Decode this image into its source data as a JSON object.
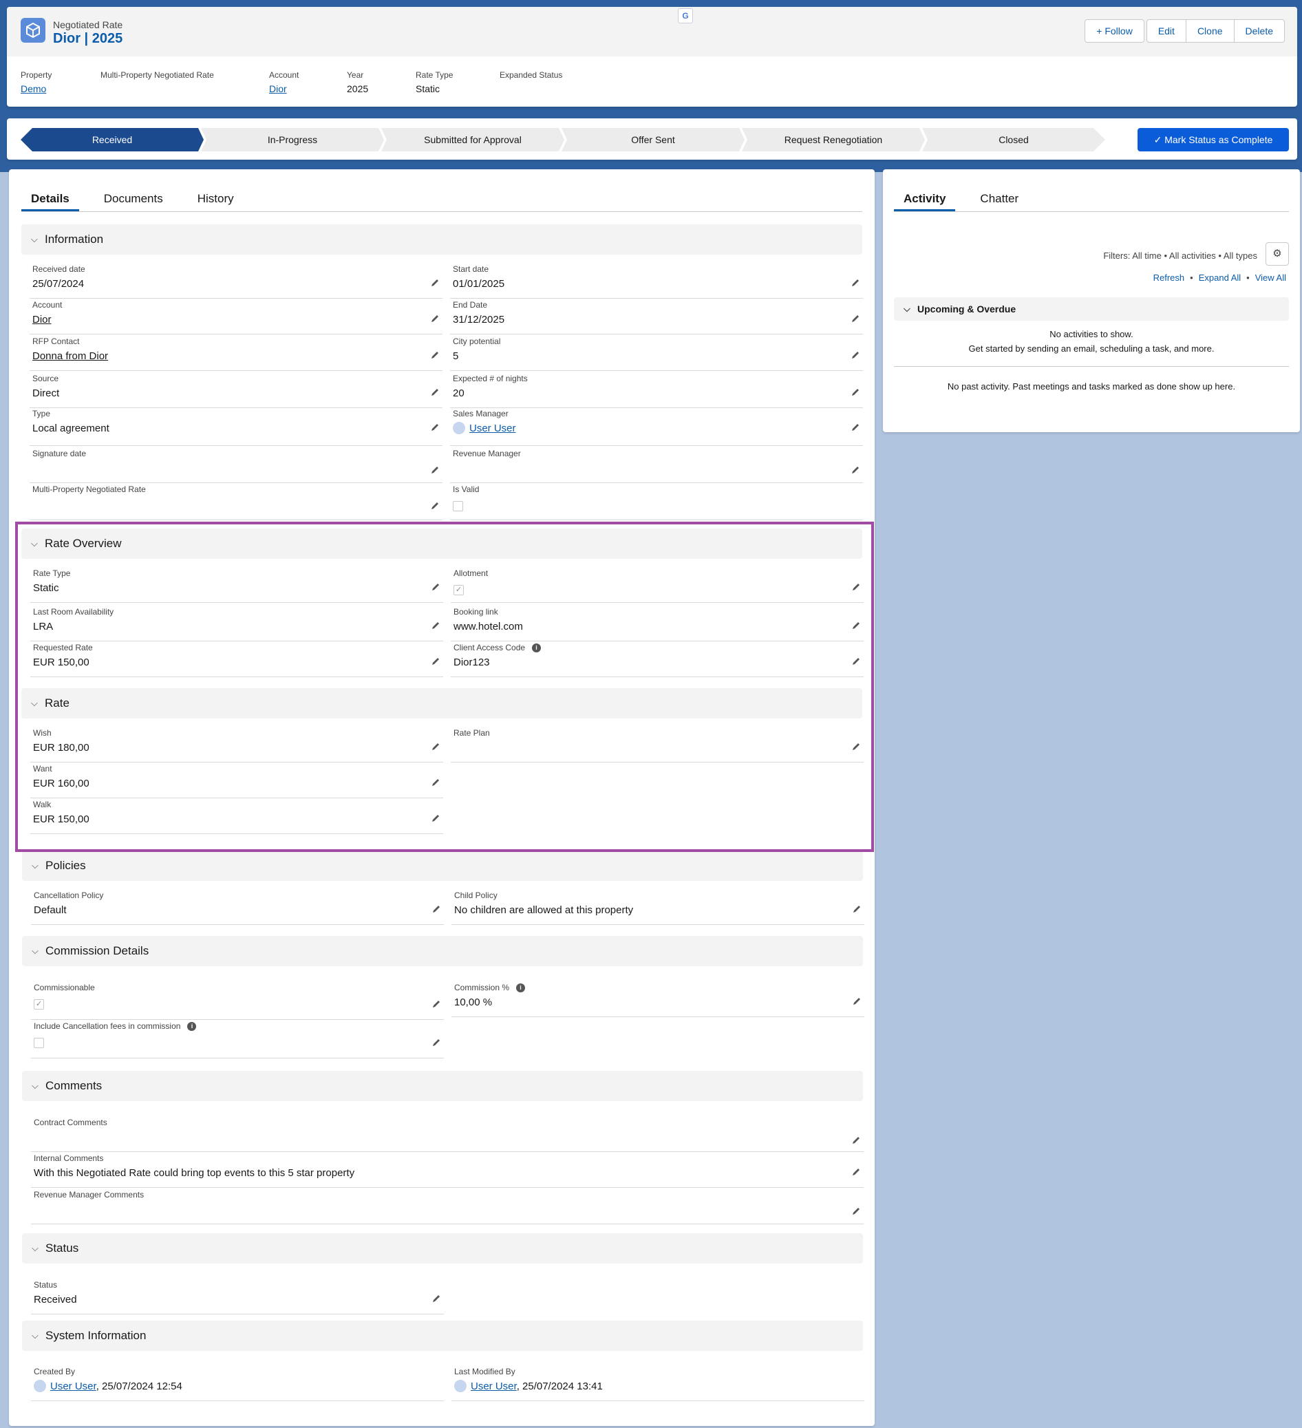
{
  "header": {
    "object_type": "Negotiated Rate",
    "title": "Dior | 2025",
    "buttons": {
      "follow": "Follow",
      "edit": "Edit",
      "clone": "Clone",
      "delete": "Delete"
    },
    "highlights": [
      {
        "label": "Property",
        "value": "Demo",
        "link": true
      },
      {
        "label": "Multi-Property Negotiated Rate",
        "value": "",
        "link": false
      },
      {
        "label": "Account",
        "value": "Dior",
        "link": true
      },
      {
        "label": "Year",
        "value": "2025",
        "link": false
      },
      {
        "label": "Rate Type",
        "value": "Static",
        "link": false
      },
      {
        "label": "Expanded Status",
        "value": "",
        "link": false
      }
    ]
  },
  "path": {
    "stages": [
      "Received",
      "In-Progress",
      "Submitted for Approval",
      "Offer Sent",
      "Request Renegotiation",
      "Closed"
    ],
    "active": "Received",
    "mark_button": "Mark Status as Complete"
  },
  "details": {
    "tabs": [
      "Details",
      "Documents",
      "History"
    ],
    "active_tab": "Details",
    "sections": {
      "information": "Information",
      "rate_overview": "Rate Overview",
      "rate": "Rate",
      "policies": "Policies",
      "commission": "Commission Details",
      "comments": "Comments",
      "status": "Status",
      "system": "System Information"
    },
    "fields": {
      "received_date": {
        "label": "Received date",
        "value": "25/07/2024"
      },
      "start_date": {
        "label": "Start date",
        "value": "01/01/2025"
      },
      "account": {
        "label": "Account",
        "value": "Dior"
      },
      "end_date": {
        "label": "End Date",
        "value": "31/12/2025"
      },
      "rfp_contact": {
        "label": "RFP Contact",
        "value": "Donna from Dior"
      },
      "city_potential": {
        "label": "City potential",
        "value": "5"
      },
      "source": {
        "label": "Source",
        "value": "Direct"
      },
      "expected_nights": {
        "label": "Expected # of nights",
        "value": "20"
      },
      "type": {
        "label": "Type",
        "value": "Local agreement"
      },
      "sales_manager": {
        "label": "Sales Manager",
        "value": "User User"
      },
      "signature_date": {
        "label": "Signature date",
        "value": ""
      },
      "revenue_manager": {
        "label": "Revenue Manager",
        "value": ""
      },
      "multi_property": {
        "label": "Multi-Property Negotiated Rate",
        "value": ""
      },
      "is_valid": {
        "label": "Is Valid",
        "checked": false
      },
      "rate_type": {
        "label": "Rate Type",
        "value": "Static"
      },
      "allotment": {
        "label": "Allotment",
        "checked": true
      },
      "lra": {
        "label": "Last Room Availability",
        "value": "LRA"
      },
      "booking_link": {
        "label": "Booking link",
        "value": "www.hotel.com"
      },
      "requested_rate": {
        "label": "Requested Rate",
        "value": "EUR 150,00"
      },
      "client_access_code": {
        "label": "Client Access Code",
        "value": "Dior123"
      },
      "wish": {
        "label": "Wish",
        "value": "EUR 180,00"
      },
      "rate_plan": {
        "label": "Rate Plan",
        "value": ""
      },
      "want": {
        "label": "Want",
        "value": "EUR 160,00"
      },
      "walk": {
        "label": "Walk",
        "value": "EUR 150,00"
      },
      "cancellation_policy": {
        "label": "Cancellation Policy",
        "value": "Default"
      },
      "child_policy": {
        "label": "Child Policy",
        "value": "No children are allowed at this property"
      },
      "commissionable": {
        "label": "Commissionable",
        "checked": true
      },
      "commission_pct": {
        "label": "Commission %",
        "value": "10,00 %"
      },
      "include_cancel_fees": {
        "label": "Include Cancellation fees in commission",
        "checked": false
      },
      "contract_comments": {
        "label": "Contract Comments",
        "value": ""
      },
      "internal_comments": {
        "label": "Internal Comments",
        "value": "With this Negotiated Rate could bring top events to this 5 star property"
      },
      "rm_comments": {
        "label": "Revenue Manager Comments",
        "value": ""
      },
      "status": {
        "label": "Status",
        "value": "Received"
      },
      "created_by": {
        "label": "Created By",
        "user": "User User",
        "date": ", 25/07/2024 12:54"
      },
      "last_modified_by": {
        "label": "Last Modified By",
        "user": "User User",
        "date": ", 25/07/2024 13:41"
      }
    }
  },
  "activity": {
    "tabs": [
      "Activity",
      "Chatter"
    ],
    "active_tab": "Activity",
    "filters": "Filters: All time • All activities • All types",
    "links": [
      "Refresh",
      "Expand All",
      "View All"
    ],
    "upcoming_title": "Upcoming & Overdue",
    "no_activities": "No activities to show.",
    "get_started": "Get started by sending an email, scheduling a task, and more.",
    "no_past": "No past activity. Past meetings and tasks marked as done show up here."
  },
  "icons": {
    "object": "negotiated-rate-cube-icon",
    "pencil": "pencil-icon",
    "chevron": "chevron-down-icon",
    "gear": "gear-icon",
    "info": "info-icon"
  },
  "colors": {
    "brand": "#0b5cab",
    "path_active": "#1b4a8f",
    "mark_button": "#0b5cd9",
    "highlight_border": "#a24ba4"
  }
}
